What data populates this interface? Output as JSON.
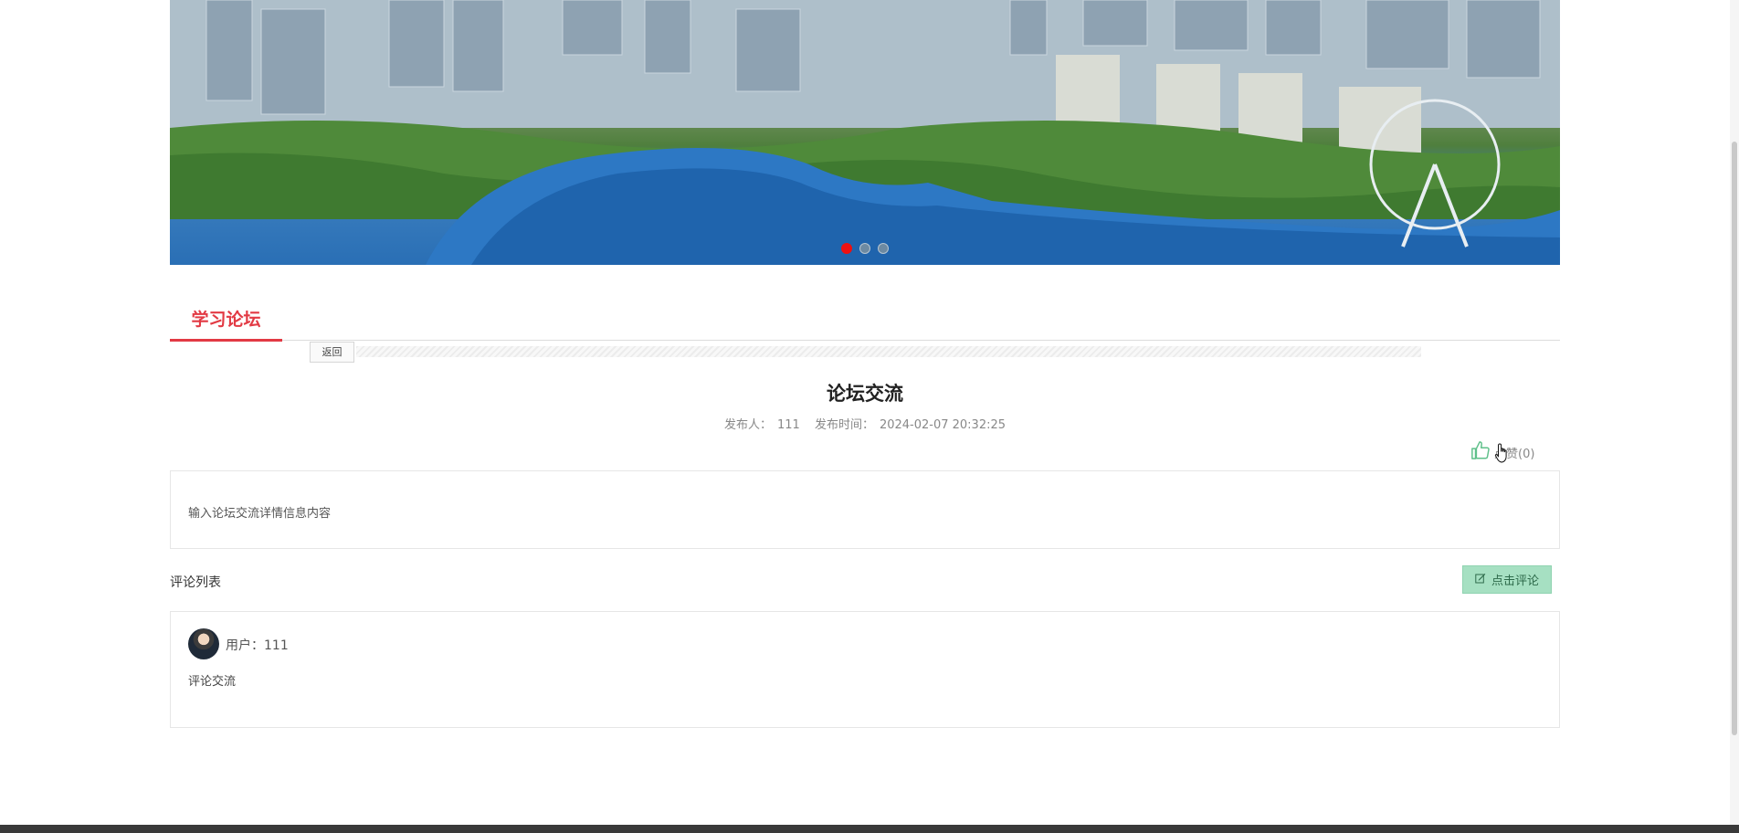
{
  "banner": {
    "slide_count": 3,
    "active_slide": 1,
    "colors": {
      "active_dot": "#ee1111",
      "inactive_dot": "#6d8aa2"
    }
  },
  "section": {
    "tab_label": "学习论坛",
    "accent": "#e23a44"
  },
  "nav": {
    "back_label": "返回"
  },
  "post": {
    "title": "论坛交流",
    "author_label": "发布人：",
    "author": "111",
    "time_label": "发布时间：",
    "time": "2024-02-07 20:32:25",
    "like_label": "点赞(0)",
    "content": "输入论坛交流详情信息内容"
  },
  "comments": {
    "title": "评论列表",
    "add_button_label": "点击评论",
    "items": [
      {
        "user_label": "用户：",
        "user": "111",
        "text": "评论交流"
      }
    ]
  },
  "icons": {
    "like": "thumbs-up-icon",
    "edit": "edit-icon",
    "cursor": "hand-pointer-icon"
  }
}
